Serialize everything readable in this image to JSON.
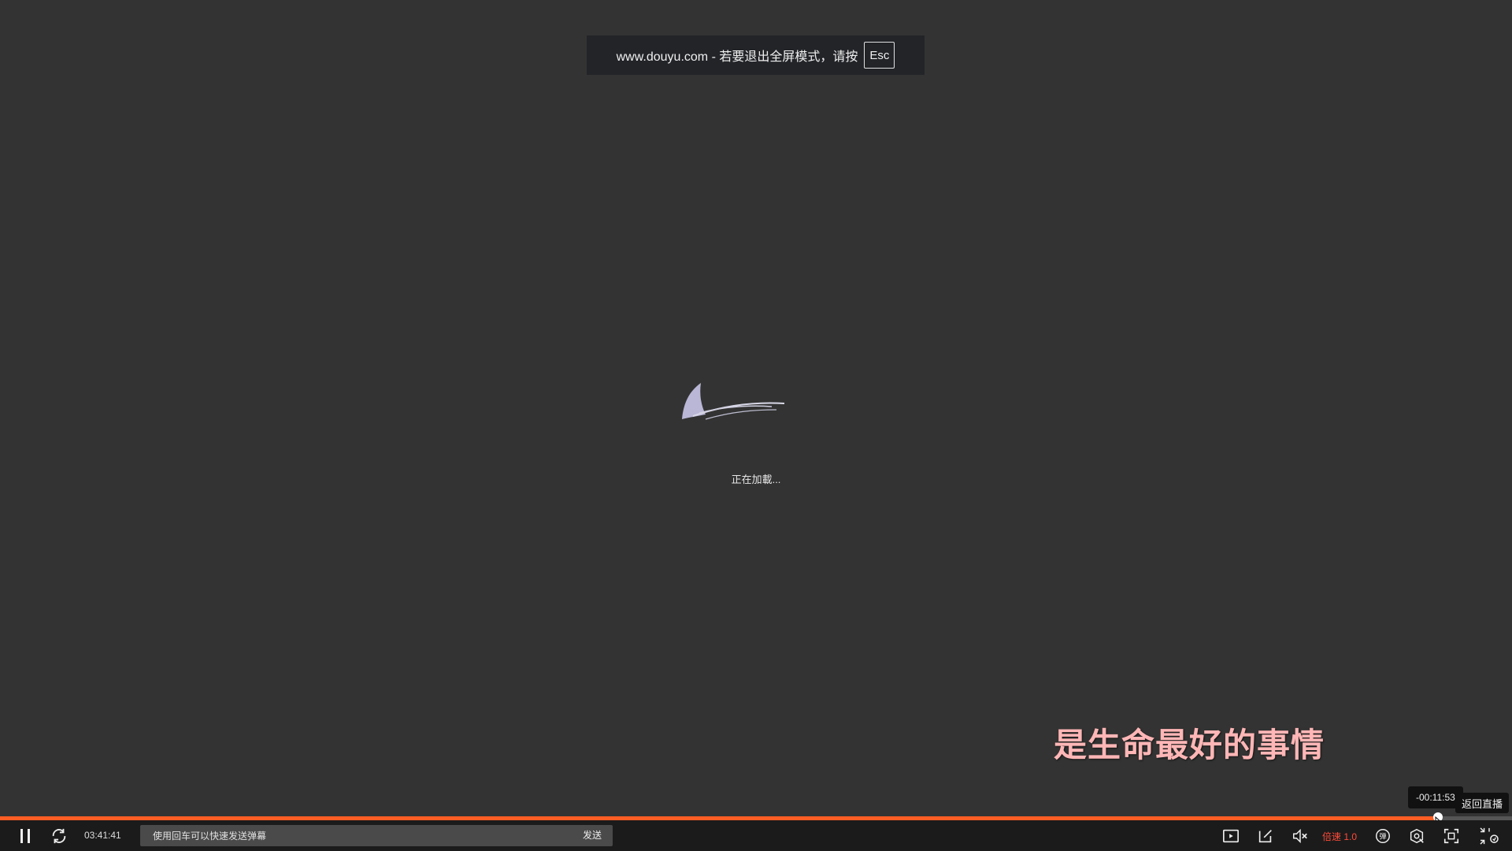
{
  "fullscreen_notice": {
    "text": "www.douyu.com - 若要退出全屏模式，请按",
    "key": "Esc"
  },
  "loading": {
    "text": "正在加載..."
  },
  "danmaku": {
    "subtitle": "是生命最好的事情"
  },
  "seek": {
    "tooltip_time": "-00:11:53",
    "back_to_live": "返回直播",
    "progress_fraction": 0.951
  },
  "controls": {
    "current_time": "03:41:41",
    "danmaku_placeholder": "使用回车可以快速发送弹幕",
    "send_label": "发送",
    "speed_label": "倍速 1.0",
    "danmaku_toggle_label": "弹"
  },
  "colors": {
    "background": "#333333",
    "accent": "#ff5d23",
    "speed": "#ff4b3a",
    "subtitle": "#ffb6b6"
  }
}
